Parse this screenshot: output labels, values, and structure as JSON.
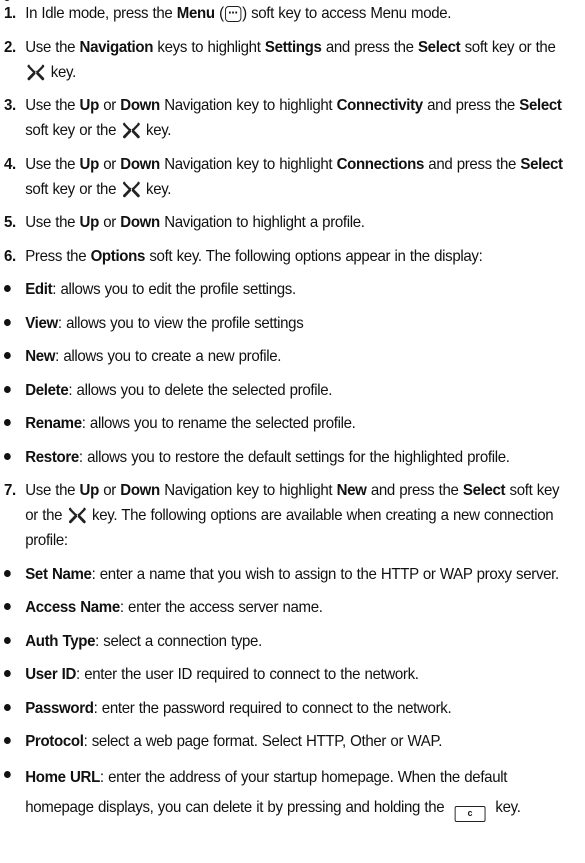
{
  "steps": [
    {
      "num": "1.",
      "parts": {
        "a": "In Idle mode, press the ",
        "b": "Menu",
        "c": " (",
        "d": ") soft key to access Menu mode."
      }
    },
    {
      "num": "2.",
      "parts": {
        "a": "Use the ",
        "b": "Navigation",
        "c": " keys to highlight ",
        "d": "Settings",
        "e": " and press the ",
        "f": "Select",
        "g": " soft key or the ",
        "h": " key."
      }
    },
    {
      "num": "3.",
      "parts": {
        "a": "Use the ",
        "b": "Up",
        "c": " or ",
        "d": "Down",
        "e": " Navigation key to highlight ",
        "f": "Connectivity",
        "g": " and press the ",
        "h": "Select",
        "i": " soft key or the ",
        "j": " key."
      }
    },
    {
      "num": "4.",
      "parts": {
        "a": "Use the ",
        "b": "Up",
        "c": " or ",
        "d": "Down",
        "e": " Navigation key to highlight ",
        "f": "Connections",
        "g": " and press the ",
        "h": "Select",
        "i": " soft key or the ",
        "j": " key."
      }
    },
    {
      "num": "5.",
      "parts": {
        "a": "Use the ",
        "b": "Up",
        "c": " or ",
        "d": "Down",
        "e": " Navigation to highlight a profile."
      }
    },
    {
      "num": "6.",
      "parts": {
        "a": "Press the ",
        "b": "Options",
        "c": " soft key. The following options appear in the display:"
      }
    },
    {
      "num": "7.",
      "parts": {
        "a": "Use the ",
        "b": "Up",
        "c": " or ",
        "d": "Down",
        "e": " Navigation key to highlight ",
        "f": "New",
        "g": " and press the ",
        "h": "Select",
        "i": " soft key or the ",
        "j": " key. The following options are available when creating a new connection profile:"
      }
    }
  ],
  "options": [
    {
      "term": "Edit",
      "desc": ": allows you to edit the profile settings."
    },
    {
      "term": "View",
      "desc": ": allows you to view the profile settings"
    },
    {
      "term": "New",
      "desc": ": allows you to create a new profile."
    },
    {
      "term": "Delete",
      "desc": ": allows you to delete the selected profile."
    },
    {
      "term": "Rename",
      "desc": ": allows you to rename the selected profile."
    },
    {
      "term": "Restore",
      "desc": ": allows you to restore the default settings for the highlighted profile."
    }
  ],
  "new_profile_fields": [
    {
      "term": "Set Name",
      "desc": ": enter a name that you wish to assign to the HTTP or WAP proxy server."
    },
    {
      "term": "Access Name",
      "desc": ": enter the access server name."
    },
    {
      "term": "Auth Type",
      "desc": ": select a connection type."
    },
    {
      "term": "User ID",
      "desc": ": enter the user ID required to connect to the network."
    },
    {
      "term": "Password",
      "desc": ": enter the password required to connect to the network."
    },
    {
      "term": "Protocol",
      "desc": ": select a web page format. Select HTTP, Other or WAP."
    },
    {
      "term": "Home URL",
      "desc": ": enter the address of your startup homepage. When the default homepage displays, you can delete it by pressing and holding the ",
      "desc_end": " key."
    }
  ],
  "icons": {
    "menu_key": "menu-key-icon",
    "ok_key": "ok-key-icon",
    "clear_key": "clear-key-icon",
    "clear_key_label": "c"
  }
}
